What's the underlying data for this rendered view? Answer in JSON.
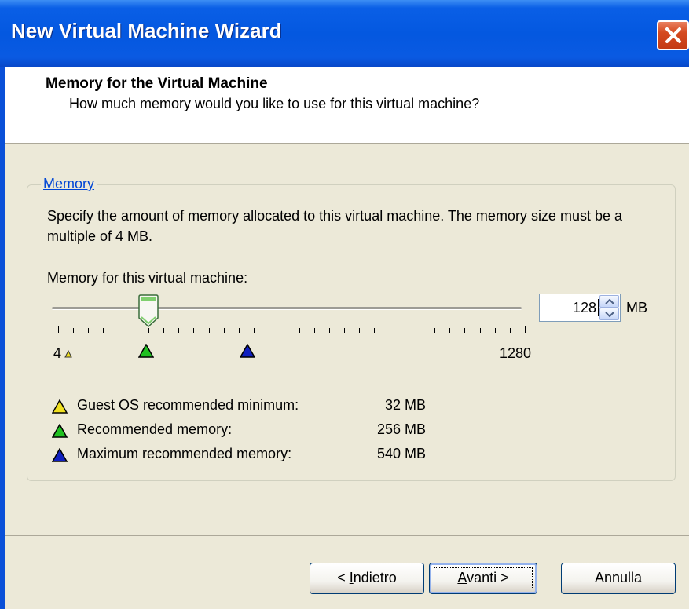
{
  "window": {
    "title": "New Virtual Machine Wizard",
    "close_icon": "close-icon"
  },
  "header": {
    "title": "Memory for the Virtual Machine",
    "subtitle": "How much memory would you like to use for this virtual machine?"
  },
  "memory_group": {
    "label": "Memory",
    "description": "Specify the amount of memory allocated to this virtual machine. The memory size must be a multiple of 4 MB.",
    "field_label": "Memory for this virtual machine:",
    "slider": {
      "min_label": "4",
      "max_label": "1280",
      "value": 128,
      "min": 4,
      "max": 1280
    },
    "spinner": {
      "value": "128",
      "unit": "MB"
    },
    "legend": [
      {
        "label": "Guest OS recommended minimum:",
        "value": "32 MB",
        "color": "#f0e020",
        "icon": "yellow-triangle-icon"
      },
      {
        "label": "Recommended memory:",
        "value": "256 MB",
        "color": "#20c020",
        "icon": "green-triangle-icon"
      },
      {
        "label": "Maximum recommended memory:",
        "value": "540 MB",
        "color": "#1020c0",
        "icon": "blue-triangle-icon"
      }
    ]
  },
  "buttons": {
    "back_prefix": "< ",
    "back_accel": "I",
    "back_rest": "ndietro",
    "next_accel": "A",
    "next_rest": "vanti >",
    "cancel": "Annulla"
  },
  "colors": {
    "titlebar": "#0458e0",
    "dialog_bg": "#ece9d8",
    "link_blue": "#0046d5"
  }
}
